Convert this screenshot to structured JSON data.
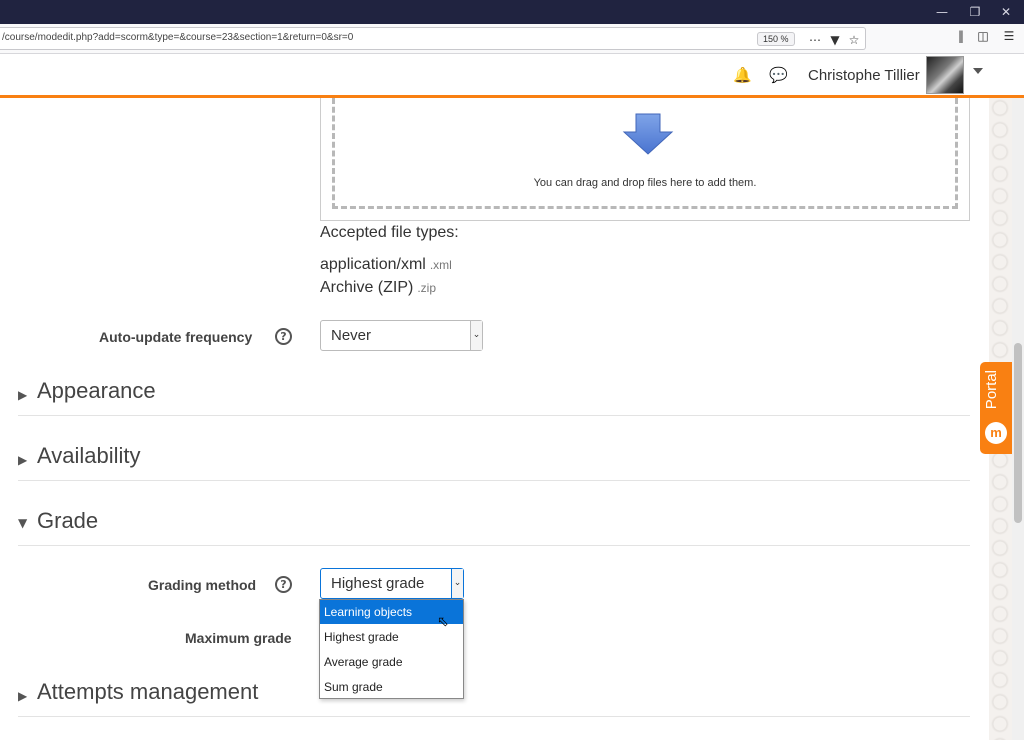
{
  "browser": {
    "url": "/course/modedit.php?add=scorm&type=&course=23&section=1&return=0&sr=0",
    "zoom": "150 %",
    "minimize_icon": "minimize-icon",
    "restore_icon": "restore-icon",
    "close_icon": "close-icon"
  },
  "header": {
    "user_name": "Christophe Tillier",
    "notification_icon": "bell-icon",
    "messages_icon": "chat-icon"
  },
  "filepicker": {
    "drop_text": "You can drag and drop files here to add them."
  },
  "accepted": {
    "label": "Accepted file types:",
    "types": [
      {
        "name": "application/xml",
        "ext": ".xml"
      },
      {
        "name": "Archive (ZIP)",
        "ext": ".zip"
      }
    ]
  },
  "auto_update": {
    "label": "Auto-update frequency",
    "value": "Never"
  },
  "sections": {
    "appearance": "Appearance",
    "availability": "Availability",
    "grade": "Grade",
    "attempts": "Attempts management"
  },
  "grading": {
    "label": "Grading method",
    "value": "Highest grade",
    "options": [
      "Learning objects",
      "Highest grade",
      "Average grade",
      "Sum grade"
    ],
    "highlighted_option": "Learning objects"
  },
  "max_grade": {
    "label": "Maximum grade"
  },
  "portal": {
    "label": "Portal",
    "logo": "m"
  },
  "colors": {
    "accent": "#f98012",
    "selection": "#0a74d9",
    "titlebar": "#202340"
  }
}
